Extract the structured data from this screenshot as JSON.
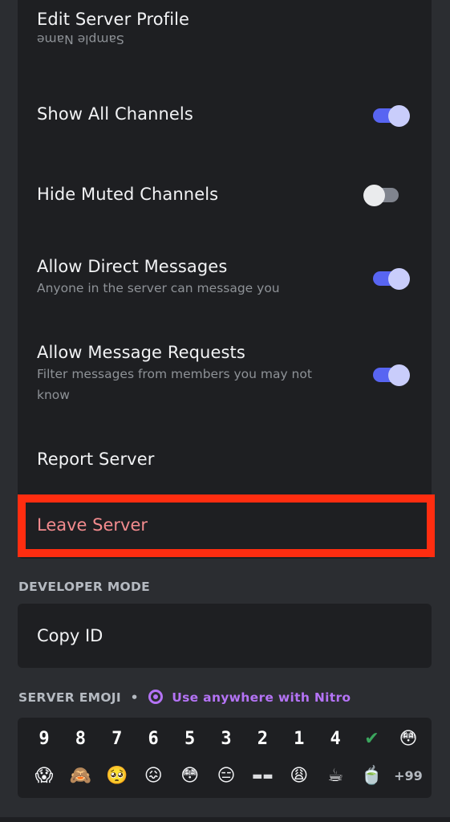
{
  "settings": {
    "edit_profile": {
      "label": "Edit Server Profile",
      "subtitle": "Sample Name"
    },
    "show_all_channels": {
      "label": "Show All Channels",
      "enabled": true
    },
    "hide_muted_channels": {
      "label": "Hide Muted Channels",
      "enabled": false
    },
    "allow_direct_messages": {
      "label": "Allow Direct Messages",
      "subtitle": "Anyone in the server can message you",
      "enabled": true
    },
    "allow_message_requests": {
      "label": "Allow Message Requests",
      "subtitle": "Filter messages from members you may not know",
      "enabled": true
    },
    "report_server": {
      "label": "Report Server"
    },
    "leave_server": {
      "label": "Leave Server"
    }
  },
  "developer_mode": {
    "heading": "DEVELOPER MODE",
    "copy_id_label": "Copy ID"
  },
  "server_emoji": {
    "heading": "SERVER EMOJI",
    "separator": "•",
    "nitro_label": "Use anywhere with Nitro",
    "row1": [
      "9",
      "8",
      "7",
      "6",
      "5",
      "3",
      "2",
      "1",
      "4",
      "✔",
      "😳"
    ],
    "row2": [
      "😱",
      "🙈",
      "🥺",
      "😖",
      "😳",
      "😑",
      "▬▬",
      "😩",
      "☕",
      "🍵"
    ],
    "more_count": "+99"
  },
  "colors": {
    "accent": "#5865f2",
    "danger_text": "#f38b8e",
    "highlight_box": "#ff2d10",
    "nitro": "#b473f5"
  }
}
